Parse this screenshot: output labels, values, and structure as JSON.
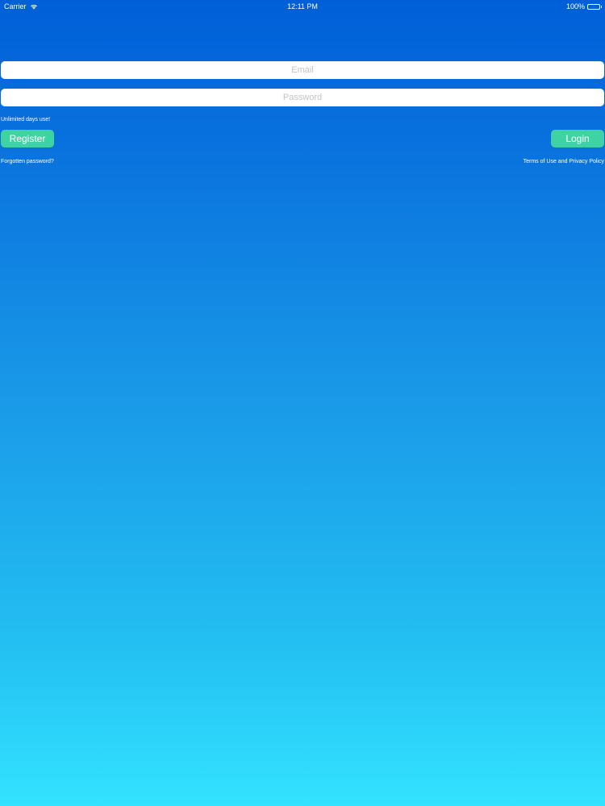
{
  "status_bar": {
    "carrier": "Carrier",
    "time": "12:11 PM",
    "battery": "100%",
    "icons": [
      "wifi-icon",
      "battery-icon"
    ]
  },
  "login_form": {
    "email_placeholder": "Email",
    "password_placeholder": "Password",
    "promo": "Unlimited days use!",
    "register_label": "Register",
    "login_label": "Login",
    "forgot_password": "Forgotten password?",
    "terms": "Terms of Use and Privacy Policy"
  },
  "colors": {
    "gradient_top": "#005fd8",
    "gradient_bottom": "#33e3ff",
    "button": "#3fd3a4",
    "field": "#ffffff",
    "placeholder": "#c4c4c8"
  }
}
